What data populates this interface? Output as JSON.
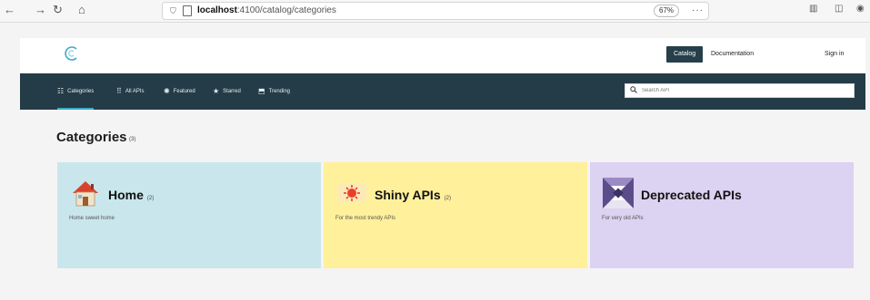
{
  "browser": {
    "url_host": "localhost",
    "url_rest": ":4100/catalog/categories",
    "zoom": "67%",
    "more": "···"
  },
  "header": {
    "catalog_label": "Catalog",
    "docs_label": "Documentation",
    "signin_label": "Sign in"
  },
  "nav": {
    "tabs": [
      {
        "label": "Categories",
        "icon": "categories-icon"
      },
      {
        "label": "All APIs",
        "icon": "grid-icon"
      },
      {
        "label": "Featured",
        "icon": "featured-icon"
      },
      {
        "label": "Starred",
        "icon": "star-icon"
      },
      {
        "label": "Trending",
        "icon": "trending-icon"
      }
    ],
    "search_placeholder": "Search API"
  },
  "page": {
    "title": "Categories",
    "count": "(3)"
  },
  "categories": [
    {
      "name": "Home",
      "count": "(2)",
      "description": "Home sweet home",
      "color": "#c9e6ec"
    },
    {
      "name": "Shiny APIs",
      "count": "(2)",
      "description": "For the most trendy APIs",
      "color": "#fff09b"
    },
    {
      "name": "Deprecated APIs",
      "count": "",
      "description": "For very old APIs",
      "color": "#dcd2f1"
    }
  ],
  "colors": {
    "navbar": "#243c47",
    "accent": "#3ea9c7"
  }
}
